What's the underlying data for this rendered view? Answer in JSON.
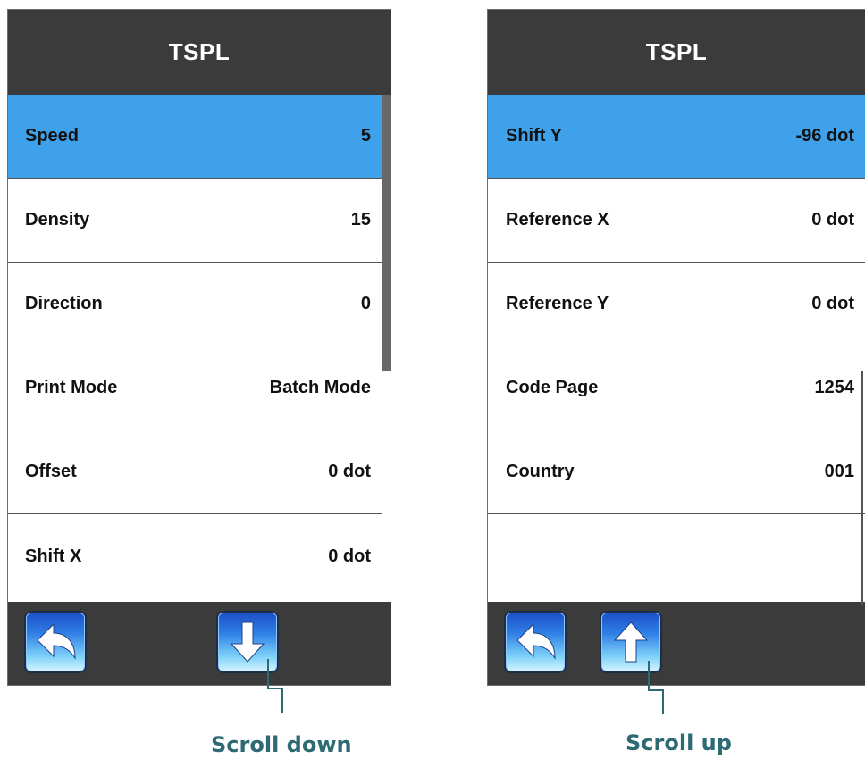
{
  "left_screen": {
    "title": "TSPL",
    "rows": [
      {
        "label": "Speed",
        "value": "5"
      },
      {
        "label": "Density",
        "value": "15"
      },
      {
        "label": "Direction",
        "value": "0"
      },
      {
        "label": "Print Mode",
        "value": "Batch Mode"
      },
      {
        "label": "Offset",
        "value": "0 dot"
      },
      {
        "label": "Shift X",
        "value": "0 dot"
      }
    ],
    "selected_row": "Speed",
    "buttons": [
      "back-icon",
      "arrow-down-icon"
    ]
  },
  "right_screen": {
    "title": "TSPL",
    "rows": [
      {
        "label": "Shift Y",
        "value": "-96 dot"
      },
      {
        "label": "Reference X",
        "value": "0 dot"
      },
      {
        "label": "Reference Y",
        "value": "0 dot"
      },
      {
        "label": "Code Page",
        "value": "1254"
      },
      {
        "label": "Country",
        "value": "001"
      }
    ],
    "selected_row": "Shift Y",
    "buttons": [
      "back-icon",
      "arrow-up-icon"
    ]
  },
  "annotations": {
    "scroll_down": "Scroll down",
    "scroll_up": "Scroll up"
  },
  "colors": {
    "header_bg": "#3b3b3b",
    "selected_row": "#3ea1ea",
    "annotation": "#2d6a74",
    "button_blue": "#2f7fe6"
  }
}
